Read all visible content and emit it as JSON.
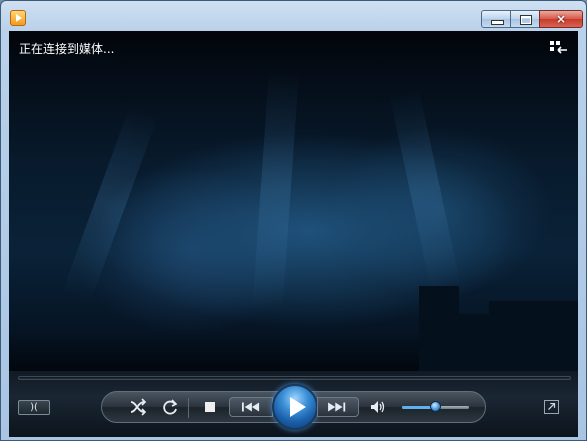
{
  "window": {
    "minimize_label": "",
    "maximize_label": "",
    "close_label": "×"
  },
  "player": {
    "status_text": "正在连接到媒体...",
    "aspect_label": ")(",
    "volume_level": 0.5
  },
  "icons": {
    "app": "media-player-icon",
    "switch_view": "switch-to-library-icon",
    "shuffle": "shuffle-icon",
    "repeat": "repeat-icon",
    "stop": "stop-icon",
    "previous": "previous-icon",
    "play": "play-icon",
    "next": "next-icon",
    "mute": "speaker-icon",
    "fullscreen": "fullscreen-icon"
  },
  "colors": {
    "accent": "#3b8fd6",
    "close_button": "#c63a2b"
  }
}
